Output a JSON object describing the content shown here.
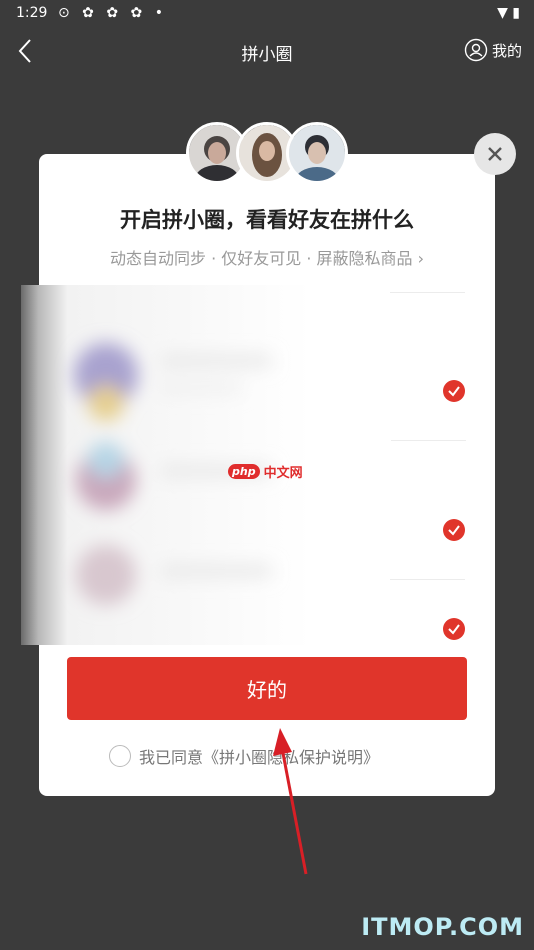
{
  "status_bar": {
    "time": "1:29",
    "icons": "⊙ ✿ ✿ ✿ •",
    "right_icons": "▼ ▮"
  },
  "nav": {
    "back_icon": "chevron-left-icon",
    "title": "拼小圈",
    "mine_label": "我的",
    "mine_icon": "user-circle-icon"
  },
  "modal": {
    "title": "开启拼小圈，看看好友在拼什么",
    "subtitle": "动态自动同步 · 仅好友可见 · 屏蔽隐私商品 ›",
    "ok_label": "好的",
    "agree_text": "我已同意《拼小圈隐私保护说明》",
    "close_icon": "close-icon",
    "check_icon": "check-circle-icon",
    "accent_color": "#e0352b"
  },
  "watermarks": {
    "php_badge": "php",
    "php_text": "中文网",
    "site": "ITMOP.COM"
  }
}
